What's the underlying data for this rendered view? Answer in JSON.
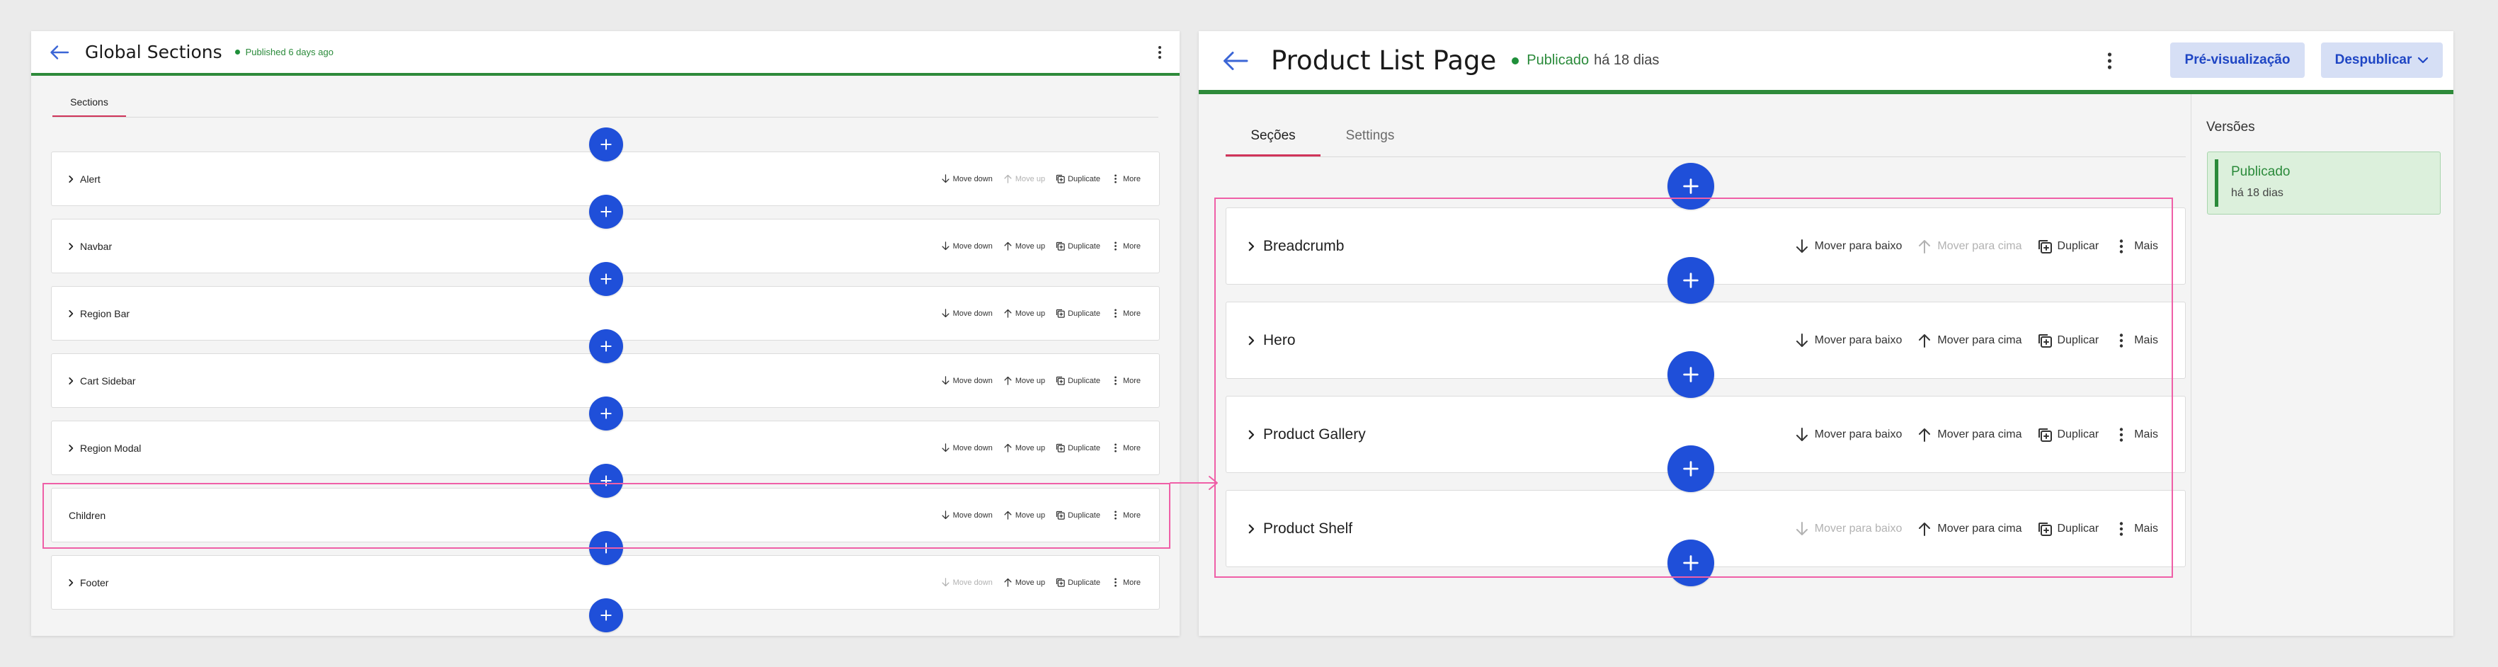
{
  "left_panel": {
    "title": "Global Sections",
    "status": "Published 6 days ago",
    "tabs": [
      {
        "label": "Sections"
      }
    ],
    "sections": [
      {
        "name": "Alert",
        "expandable": true,
        "move_down_enabled": true,
        "move_up_enabled": false
      },
      {
        "name": "Navbar",
        "expandable": true,
        "move_down_enabled": true,
        "move_up_enabled": true
      },
      {
        "name": "Region Bar",
        "expandable": true,
        "move_down_enabled": true,
        "move_up_enabled": true
      },
      {
        "name": "Cart Sidebar",
        "expandable": true,
        "move_down_enabled": true,
        "move_up_enabled": true
      },
      {
        "name": "Region Modal",
        "expandable": true,
        "move_down_enabled": true,
        "move_up_enabled": true
      },
      {
        "name": "Children",
        "expandable": false,
        "move_down_enabled": true,
        "move_up_enabled": true
      },
      {
        "name": "Footer",
        "expandable": true,
        "move_down_enabled": false,
        "move_up_enabled": true
      }
    ],
    "actions": {
      "move_down": "Move down",
      "move_up": "Move up",
      "duplicate": "Duplicate",
      "more": "More"
    }
  },
  "right_panel": {
    "title": "Product List Page",
    "status_state": "Publicado",
    "status_relative": "há 18 dias",
    "preview_button": "Pré-visualização",
    "unpublish_button": "Despublicar",
    "tabs": [
      {
        "label": "Seções"
      },
      {
        "label": "Settings"
      }
    ],
    "sections": [
      {
        "name": "Breadcrumb",
        "move_down_enabled": true,
        "move_up_enabled": false
      },
      {
        "name": "Hero",
        "move_down_enabled": true,
        "move_up_enabled": true
      },
      {
        "name": "Product Gallery",
        "move_down_enabled": true,
        "move_up_enabled": true
      },
      {
        "name": "Product Shelf",
        "move_down_enabled": false,
        "move_up_enabled": true
      }
    ],
    "actions": {
      "move_down": "Mover para baixo",
      "move_up": "Mover para cima",
      "duplicate": "Duplicar",
      "more": "Mais"
    },
    "versions": {
      "heading": "Versões",
      "items": [
        {
          "state": "Publicado",
          "relative": "há 18 dias"
        }
      ]
    }
  },
  "colors": {
    "accent_blue": "#1f4fd9",
    "published_green": "#1f8f3a",
    "tab_active": "#d0345a",
    "highlight_pink": "#ef5fa7"
  }
}
